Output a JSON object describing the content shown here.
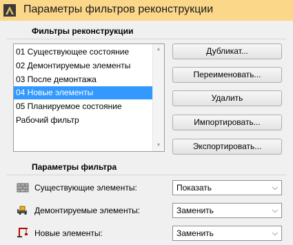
{
  "window": {
    "title": "Параметры фильтров реконструкции",
    "icon": "archicad-logo-icon"
  },
  "filters_section": {
    "heading": "Фильтры реконструкции",
    "items": [
      {
        "label": "01 Существующее состояние",
        "selected": false
      },
      {
        "label": "02 Демонтируемые элементы",
        "selected": false
      },
      {
        "label": "03 После демонтажа",
        "selected": false
      },
      {
        "label": "04 Новые элементы",
        "selected": true
      },
      {
        "label": "05 Планируемое состояние",
        "selected": false
      },
      {
        "label": "Рабочий фильтр",
        "selected": false
      }
    ],
    "buttons": {
      "duplicate": "Дубликат...",
      "rename": "Переименовать...",
      "delete": "Удалить",
      "import": "Импортировать...",
      "export": "Экспортировать..."
    }
  },
  "params_section": {
    "heading": "Параметры фильтра",
    "rows": [
      {
        "label": "Существующие элементы:",
        "value": "Показать",
        "icon": "existing-wall-icon"
      },
      {
        "label": "Демонтируемые элементы:",
        "value": "Заменить",
        "icon": "demolish-bulldozer-icon"
      },
      {
        "label": "Новые элементы:",
        "value": "Заменить",
        "icon": "new-crane-icon"
      }
    ]
  },
  "colors": {
    "titlebar": "#fbd78a",
    "panel": "#f0f0f0",
    "selection": "#3399ff"
  }
}
